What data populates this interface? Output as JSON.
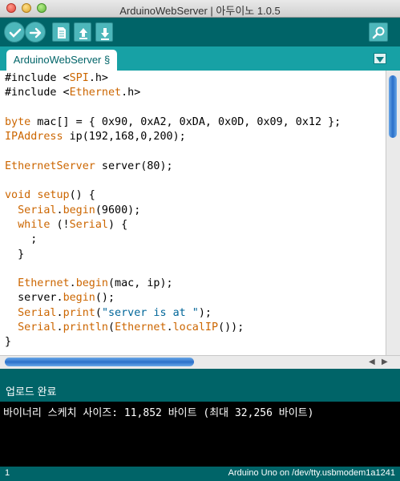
{
  "window": {
    "title": "ArduinoWebServer | 아두이노 1.0.5"
  },
  "toolbar": {
    "buttons": [
      {
        "name": "verify",
        "icon": "check-icon"
      },
      {
        "name": "upload",
        "icon": "arrow-right-icon"
      },
      {
        "name": "new",
        "icon": "new-file-icon"
      },
      {
        "name": "open",
        "icon": "upload-arrow-icon"
      },
      {
        "name": "save",
        "icon": "download-arrow-icon"
      },
      {
        "name": "serial-monitor",
        "icon": "magnifier-icon"
      }
    ]
  },
  "tabs": [
    {
      "label": "ArduinoWebServer §",
      "active": true
    }
  ],
  "editor": {
    "code_lines": [
      "#include <SPI.h>",
      "#include <Ethernet.h>",
      "",
      "byte mac[] = { 0x90, 0xA2, 0xDA, 0x0D, 0x09, 0x12 };",
      "IPAddress ip(192,168,0,200);",
      "",
      "EthernetServer server(80);",
      "",
      "void setup() {",
      "  Serial.begin(9600);",
      "  while (!Serial) {",
      "    ;",
      "  }",
      "",
      "  Ethernet.begin(mac, ip);",
      "  server.begin();",
      "  Serial.print(\"server is at \");",
      "  Serial.println(Ethernet.localIP());",
      "}"
    ]
  },
  "status": {
    "message": "업로드 완료"
  },
  "console": {
    "output": "바이너리 스케치 사이즈: 11,852 바이트 (최대 32,256 바이트)"
  },
  "footer": {
    "line_number": "1",
    "board": "Arduino Uno on /dev/tty.usbmodem1a1241"
  },
  "colors": {
    "toolbar": "#006468",
    "tabbar": "#17a1a5",
    "button": "#4db7bb",
    "keyword": "#cc6600",
    "string": "#006699"
  }
}
